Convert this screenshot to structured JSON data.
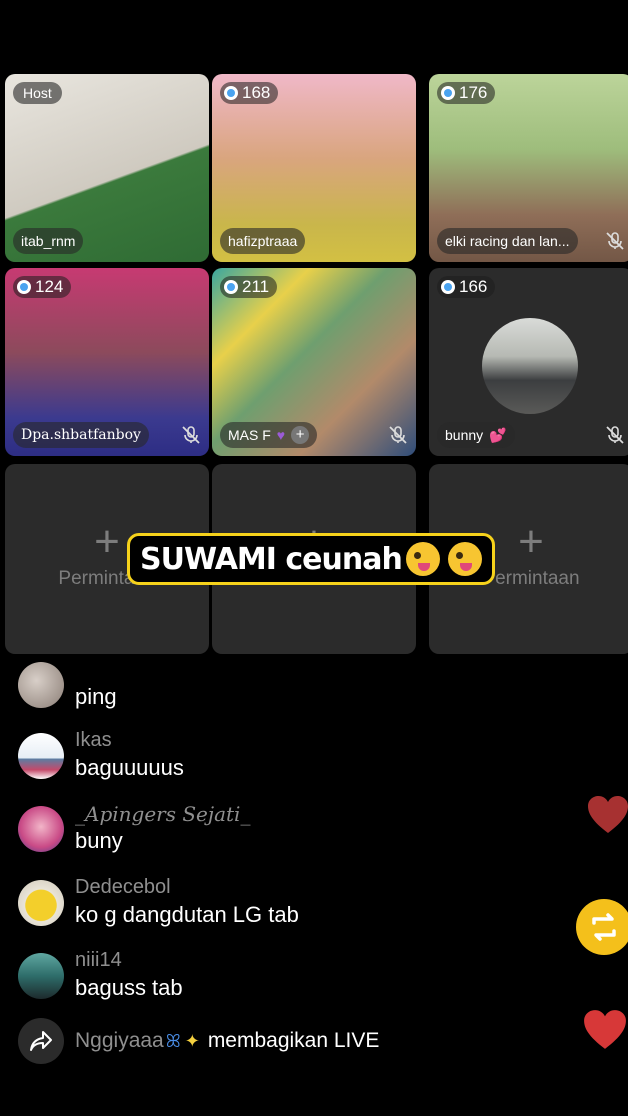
{
  "tiles": [
    {
      "badge": "Host",
      "name": "itab_rnm"
    },
    {
      "badge": "168",
      "name": "hafizptraaa"
    },
    {
      "badge": "176",
      "name": "elki racing dan lan..."
    },
    {
      "badge": "124",
      "name": "Dpa.shbatfanboy"
    },
    {
      "badge": "211",
      "name": "MAS F"
    },
    {
      "badge": "166",
      "name": "bunny"
    }
  ],
  "request_tiles": [
    {
      "label": "Permintaan"
    },
    {
      "label": "Permintaan"
    },
    {
      "label": "Permintaan"
    }
  ],
  "caption": "SUWAMI ceunah",
  "comments": [
    {
      "user": "",
      "text": "ping"
    },
    {
      "user": "Ikas",
      "text": "baguuuuus"
    },
    {
      "user": "_Apingers Sejati_",
      "text": "buny"
    },
    {
      "user": "Dedecebol",
      "text": "ko g dangdutan LG tab"
    },
    {
      "user": "niii14",
      "text": "baguss tab"
    }
  ],
  "share_event": {
    "user": "Nggiyaaa",
    "text": "membagikan LIVE"
  },
  "colors": {
    "accent_yellow": "#f6d21b",
    "heart_red": "#d23a3a",
    "repost_yellow": "#f4c01b"
  }
}
